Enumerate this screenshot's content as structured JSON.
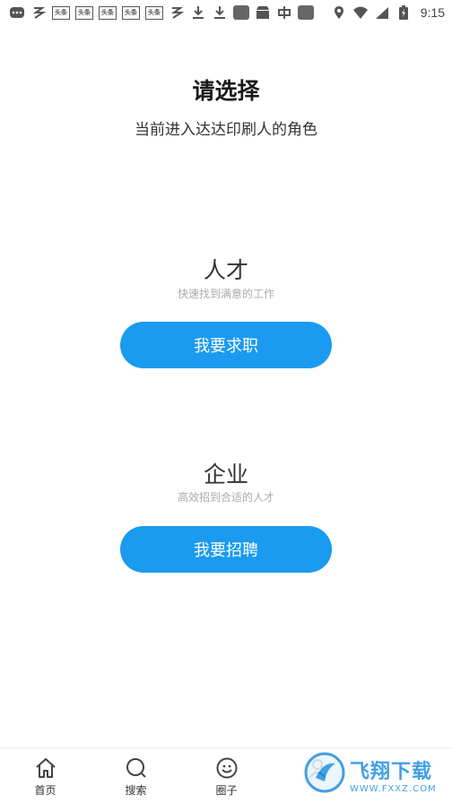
{
  "status_bar": {
    "time": "9:15",
    "news_badge": "头条"
  },
  "header": {
    "title": "请选择",
    "subtitle": "当前进入达达印刷人的角色"
  },
  "roles": [
    {
      "name": "人才",
      "description": "快速找到满意的工作",
      "button_label": "我要求职"
    },
    {
      "name": "企业",
      "description": "高效招到合适的人才",
      "button_label": "我要招聘"
    }
  ],
  "bottom_nav": {
    "items": [
      {
        "label": "首页",
        "icon": "home-icon"
      },
      {
        "label": "搜索",
        "icon": "search-icon"
      },
      {
        "label": "圈子",
        "icon": "circle-icon"
      },
      {
        "label": "",
        "icon": "profile-icon"
      }
    ]
  },
  "watermark": {
    "text_cn": "飞翔下载",
    "text_en": "WWW.FXXZ.COM"
  },
  "colors": {
    "accent": "#1a9bf0",
    "desc_text": "#aaaaaa"
  }
}
